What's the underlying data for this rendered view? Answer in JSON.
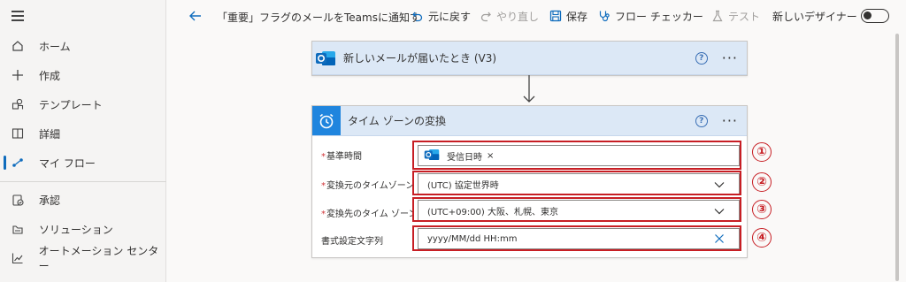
{
  "sidebar": {
    "items": [
      {
        "label": "ホーム",
        "icon": "home-icon"
      },
      {
        "label": "作成",
        "icon": "plus-icon"
      },
      {
        "label": "テンプレート",
        "icon": "template-icon"
      },
      {
        "label": "詳細",
        "icon": "book-icon"
      },
      {
        "label": "マイ フロー",
        "icon": "flow-icon",
        "active": true
      },
      {
        "label": "承認",
        "icon": "approval-icon"
      },
      {
        "label": "ソリューション",
        "icon": "solution-icon"
      },
      {
        "label": "オートメーション センター",
        "icon": "chart-icon"
      }
    ]
  },
  "toolbar": {
    "title": "「重要」フラグのメールをTeamsに通知す",
    "undo": "元に戻す",
    "redo": "やり直し",
    "save": "保存",
    "flow_checker": "フロー チェッカー",
    "test": "テスト",
    "new_designer": "新しいデザイナー"
  },
  "trigger_card": {
    "title": "新しいメールが届いたとき (V3)"
  },
  "action_card": {
    "title": "タイム ゾーンの変換",
    "fields": [
      {
        "label": "基準時間",
        "required": true,
        "token": "受信日時",
        "token_remove": "×"
      },
      {
        "label": "変換元のタイムゾーン",
        "required": true,
        "value": "(UTC) 協定世界時"
      },
      {
        "label": "変換先のタイム ゾーン",
        "required": true,
        "value": "(UTC+09:00) 大阪、札幌、東京"
      },
      {
        "label": "書式設定文字列",
        "required": false,
        "value": "yyyy/MM/dd HH:mm"
      }
    ]
  },
  "annotations": [
    "①",
    "②",
    "③",
    "④"
  ],
  "colors": {
    "accent": "#0f6cbd",
    "header": "#dce8f6",
    "highlight": "#c71e24"
  }
}
